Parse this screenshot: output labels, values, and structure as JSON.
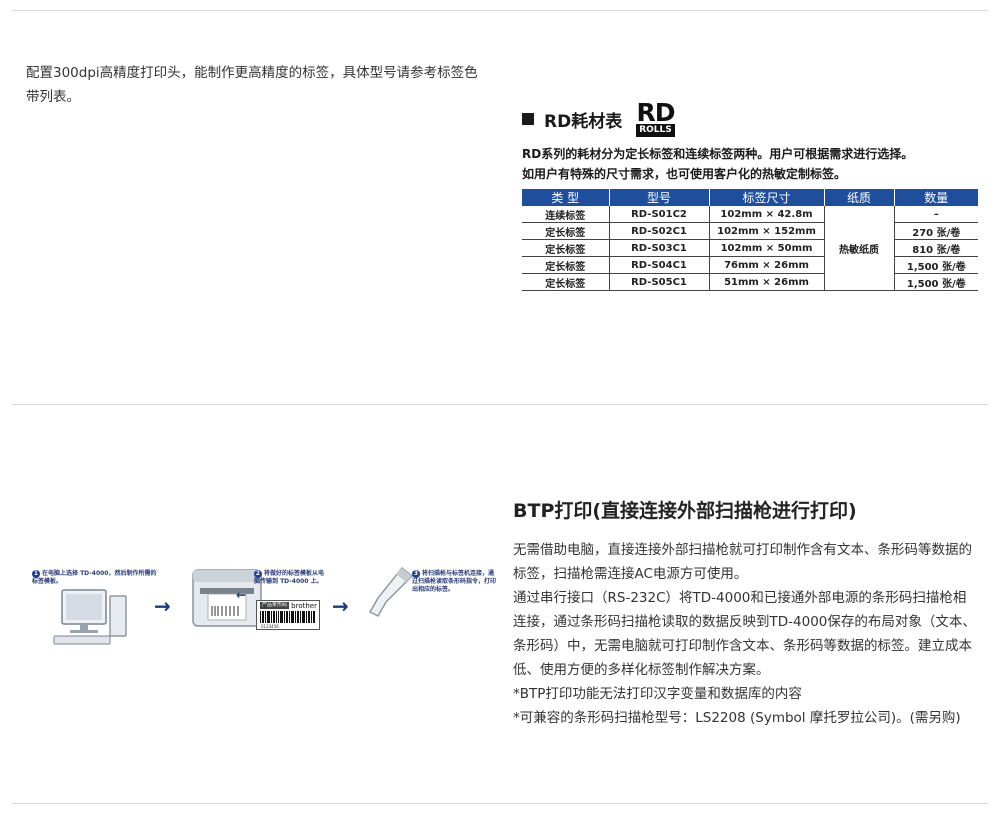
{
  "section1": {
    "description": "配置300dpi高精度打印头，能制作更高精度的标签，具体型号请参考标签色带列表。"
  },
  "rd_rolls": {
    "heading": "RD耗材表",
    "logo_top": "RD",
    "logo_bottom": "ROLLS",
    "desc_line1": "RD系列的耗材分为定长标签和连续标签两种。用户可根据需求进行选择。",
    "desc_line2": "如用户有特殊的尺寸需求，也可使用客户化的热敏定制标签。",
    "columns": [
      "类 型",
      "型号",
      "标签尺寸",
      "纸质",
      "数量"
    ],
    "rows": [
      {
        "type": "连续标签",
        "model": "RD-S01C2",
        "size": "102mm × 42.8m",
        "qty": "–"
      },
      {
        "type": "定长标签",
        "model": "RD-S02C1",
        "size": "102mm × 152mm",
        "qty": "270 张/卷"
      },
      {
        "type": "定长标签",
        "model": "RD-S03C1",
        "size": "102mm × 50mm",
        "qty": "810 张/卷"
      },
      {
        "type": "定长标签",
        "model": "RD-S04C1",
        "size": "76mm × 26mm",
        "qty": "1,500 张/卷"
      },
      {
        "type": "定长标签",
        "model": "RD-S05C1",
        "size": "51mm × 26mm",
        "qty": "1,500 张/卷"
      }
    ],
    "paper": "热敏纸质"
  },
  "btp": {
    "title": "BTP打印(直接连接外部扫描枪进行打印)",
    "p1": "无需借助电脑，直接连接外部扫描枪就可打印制作含有文本、条形码等数据的标签，扫描枪需连接AC电源方可使用。",
    "p2": "通过串行接口（RS-232C）将TD-4000和已接通外部电源的条形码扫描枪相连接，通过条形码扫描枪读取的数据反映到TD-4000保存的布局对象（文本、条形码）中，无需电脑就可打印制作含文本、条形码等数据的标签。建立成本低、使用方便的多样化标签制作解决方案。",
    "p3": "*BTP打印功能无法打印汉字变量和数据库的内容",
    "p4": "*可兼容的条形码扫描枪型号：LS2208 (Symbol 摩托罗拉公司)。(需另购)",
    "step1_num": "1",
    "step1_text": "在电脑上选择 TD-4000，然后制作所需的标签模板。",
    "step2_num": "2",
    "step2_text": "将做好的标签模板从电脑传输到 TD-4000 上。",
    "step3_num": "3",
    "step3_text": "将扫描枪与标签机连接，通过扫描枪读取条形码指令，打印出相应的标签。",
    "label_product": "产品条形码",
    "label_brand": "brother",
    "barcode_digits": "0123456"
  }
}
